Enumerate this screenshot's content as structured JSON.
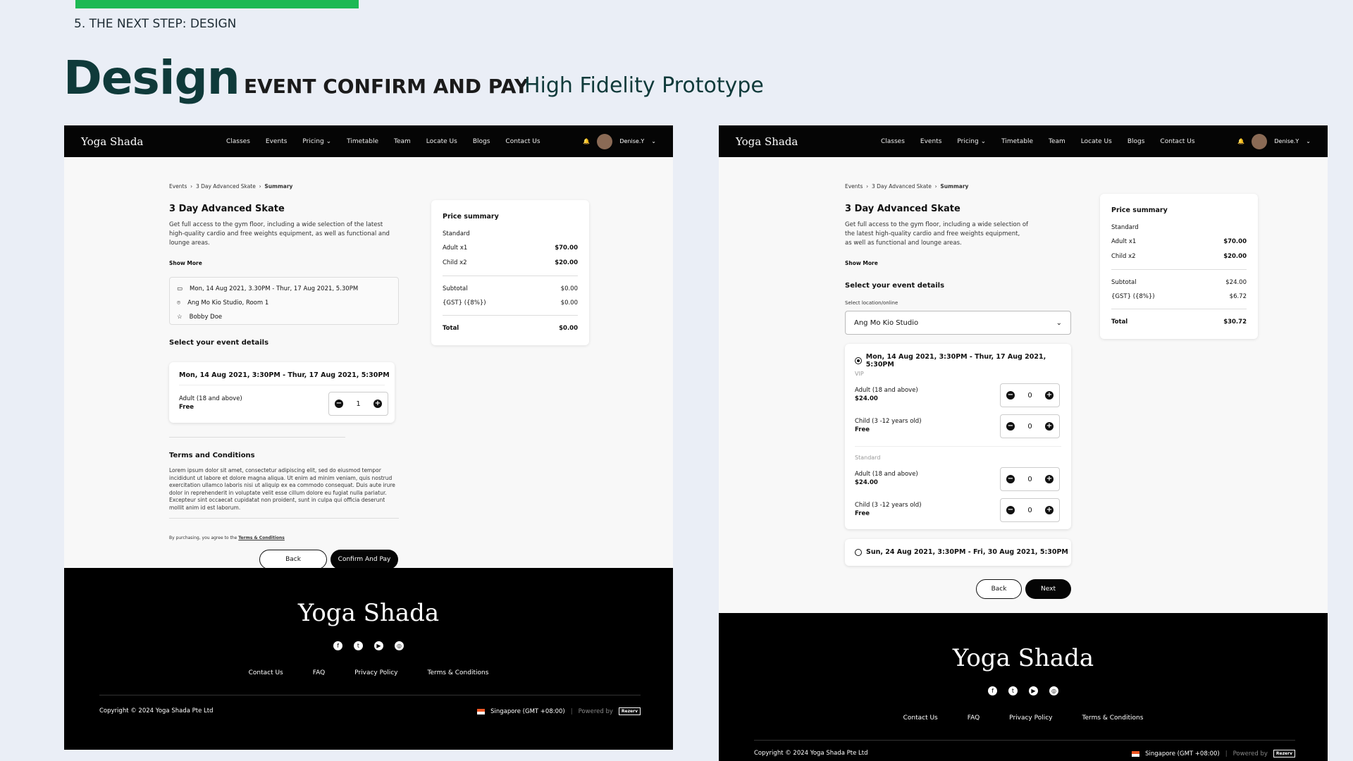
{
  "slide": {
    "step": "5. THE NEXT STEP: DESIGN",
    "title": "Design",
    "subtitle": "EVENT CONFIRM AND PAY",
    "subtitle2": "High Fidelity Prototype"
  },
  "nav": {
    "brand": "Yoga Shada",
    "items": [
      "Classes",
      "Events",
      "Pricing",
      "Timetable",
      "Team",
      "Locate Us",
      "Blogs",
      "Contact Us"
    ],
    "user": "Denise.Y"
  },
  "left": {
    "breadcrumb": [
      "Events",
      "3 Day Advanced Skate",
      "Summary"
    ],
    "event_title": "3 Day Advanced Skate",
    "description": "Get full access to the gym floor, including a wide selection of the latest high-quality cardio and free weights equipment, as well as functional and lounge areas.",
    "show_more": "Show More",
    "info": {
      "date": "Mon, 14 Aug 2021, 3.30PM - Thur, 17 Aug 2021, 5.30PM",
      "location": "Ang Mo Kio Studio, Room 1",
      "host": "Bobby Doe"
    },
    "select_title": "Select your event details",
    "session": "Mon, 14 Aug 2021, 3:30PM - Thur, 17 Aug 2021, 5:30PM",
    "ticket_label": "Adult (18 and above)",
    "ticket_price": "Free",
    "qty": "1",
    "terms_title": "Terms and Conditions",
    "terms_text": "Lorem ipsum dolor sit amet, consectetur adipiscing elit, sed do eiusmod tempor incididunt ut labore et dolore magna aliqua. Ut enim ad minim veniam, quis nostrud exercitation ullamco laboris nisi ut aliquip ex ea commodo consequat. Duis aute irure dolor in reprehenderit in voluptate velit esse cillum dolore eu fugiat nulla pariatur. Excepteur sint occaecat cupidatat non proident, sunt in culpa qui officia deserunt mollit anim id est laborum.",
    "agree_prefix": "By purchasing, you agree to the ",
    "agree_link": "Terms & Conditions",
    "back": "Back",
    "confirm": "Confirm And Pay",
    "price": {
      "title": "Price summary",
      "tier": "Standard",
      "adult_label": "Adult x1",
      "adult_value": "$70.00",
      "child_label": "Child x2",
      "child_value": "$20.00",
      "subtotal_label": "Subtotal",
      "subtotal_value": "$0.00",
      "gst_label": "{GST} ({8%})",
      "gst_value": "$0.00",
      "total_label": "Total",
      "total_value": "$0.00"
    }
  },
  "right": {
    "breadcrumb": [
      "Events",
      "3 Day Advanced Skate",
      "Summary"
    ],
    "event_title": "3 Day Advanced Skate",
    "description": "Get full access to the gym floor, including a wide selection of the latest high-quality cardio and free weights equipment, as well as functional and lounge areas.",
    "show_more": "Show More",
    "select_title": "Select your event details",
    "select_label": "Select location/online",
    "select_value": "Ang Mo Kio Studio",
    "session1": "Mon, 14 Aug 2021, 3:30PM - Thur, 17 Aug 2021, 5:30PM",
    "vip_label": "VIP",
    "standard_label": "Standard",
    "adult_label": "Adult (18 and above)",
    "adult_price": "$24.00",
    "child_label": "Child (3 -12 years old)",
    "child_price": "Free",
    "qty": "0",
    "session2": "Sun, 24 Aug 2021, 3:30PM - Fri, 30 Aug 2021, 5:30PM",
    "back": "Back",
    "next": "Next",
    "price": {
      "title": "Price summary",
      "tier": "Standard",
      "adult_label": "Adult x1",
      "adult_value": "$70.00",
      "child_label": "Child x2",
      "child_value": "$20.00",
      "subtotal_label": "Subtotal",
      "subtotal_value": "$24.00",
      "gst_label": "{GST} ({8%})",
      "gst_value": "$6.72",
      "total_label": "Total",
      "total_value": "$30.72"
    }
  },
  "footer": {
    "brand": "Yoga Shada",
    "links": [
      "Contact Us",
      "FAQ",
      "Privacy Policy",
      "Terms & Conditions"
    ],
    "copyright": "Copyright © 2024 Yoga Shada Pte Ltd",
    "region": "Singapore (GMT +08:00)",
    "powered": "Powered by",
    "powered_brand": "Rezerv"
  }
}
